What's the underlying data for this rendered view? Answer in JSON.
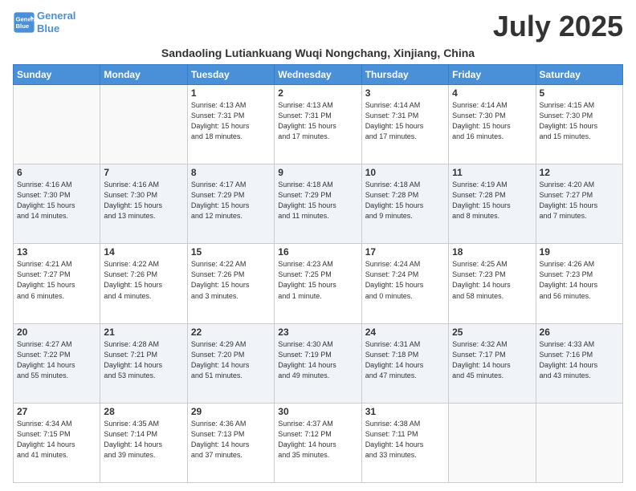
{
  "logo": {
    "line1": "General",
    "line2": "Blue"
  },
  "title": "July 2025",
  "subtitle": "Sandaoling Lutiankuang Wuqi Nongchang, Xinjiang, China",
  "days_of_week": [
    "Sunday",
    "Monday",
    "Tuesday",
    "Wednesday",
    "Thursday",
    "Friday",
    "Saturday"
  ],
  "weeks": [
    [
      {
        "day": "",
        "info": ""
      },
      {
        "day": "",
        "info": ""
      },
      {
        "day": "1",
        "info": "Sunrise: 4:13 AM\nSunset: 7:31 PM\nDaylight: 15 hours\nand 18 minutes."
      },
      {
        "day": "2",
        "info": "Sunrise: 4:13 AM\nSunset: 7:31 PM\nDaylight: 15 hours\nand 17 minutes."
      },
      {
        "day": "3",
        "info": "Sunrise: 4:14 AM\nSunset: 7:31 PM\nDaylight: 15 hours\nand 17 minutes."
      },
      {
        "day": "4",
        "info": "Sunrise: 4:14 AM\nSunset: 7:30 PM\nDaylight: 15 hours\nand 16 minutes."
      },
      {
        "day": "5",
        "info": "Sunrise: 4:15 AM\nSunset: 7:30 PM\nDaylight: 15 hours\nand 15 minutes."
      }
    ],
    [
      {
        "day": "6",
        "info": "Sunrise: 4:16 AM\nSunset: 7:30 PM\nDaylight: 15 hours\nand 14 minutes."
      },
      {
        "day": "7",
        "info": "Sunrise: 4:16 AM\nSunset: 7:30 PM\nDaylight: 15 hours\nand 13 minutes."
      },
      {
        "day": "8",
        "info": "Sunrise: 4:17 AM\nSunset: 7:29 PM\nDaylight: 15 hours\nand 12 minutes."
      },
      {
        "day": "9",
        "info": "Sunrise: 4:18 AM\nSunset: 7:29 PM\nDaylight: 15 hours\nand 11 minutes."
      },
      {
        "day": "10",
        "info": "Sunrise: 4:18 AM\nSunset: 7:28 PM\nDaylight: 15 hours\nand 9 minutes."
      },
      {
        "day": "11",
        "info": "Sunrise: 4:19 AM\nSunset: 7:28 PM\nDaylight: 15 hours\nand 8 minutes."
      },
      {
        "day": "12",
        "info": "Sunrise: 4:20 AM\nSunset: 7:27 PM\nDaylight: 15 hours\nand 7 minutes."
      }
    ],
    [
      {
        "day": "13",
        "info": "Sunrise: 4:21 AM\nSunset: 7:27 PM\nDaylight: 15 hours\nand 6 minutes."
      },
      {
        "day": "14",
        "info": "Sunrise: 4:22 AM\nSunset: 7:26 PM\nDaylight: 15 hours\nand 4 minutes."
      },
      {
        "day": "15",
        "info": "Sunrise: 4:22 AM\nSunset: 7:26 PM\nDaylight: 15 hours\nand 3 minutes."
      },
      {
        "day": "16",
        "info": "Sunrise: 4:23 AM\nSunset: 7:25 PM\nDaylight: 15 hours\nand 1 minute."
      },
      {
        "day": "17",
        "info": "Sunrise: 4:24 AM\nSunset: 7:24 PM\nDaylight: 15 hours\nand 0 minutes."
      },
      {
        "day": "18",
        "info": "Sunrise: 4:25 AM\nSunset: 7:23 PM\nDaylight: 14 hours\nand 58 minutes."
      },
      {
        "day": "19",
        "info": "Sunrise: 4:26 AM\nSunset: 7:23 PM\nDaylight: 14 hours\nand 56 minutes."
      }
    ],
    [
      {
        "day": "20",
        "info": "Sunrise: 4:27 AM\nSunset: 7:22 PM\nDaylight: 14 hours\nand 55 minutes."
      },
      {
        "day": "21",
        "info": "Sunrise: 4:28 AM\nSunset: 7:21 PM\nDaylight: 14 hours\nand 53 minutes."
      },
      {
        "day": "22",
        "info": "Sunrise: 4:29 AM\nSunset: 7:20 PM\nDaylight: 14 hours\nand 51 minutes."
      },
      {
        "day": "23",
        "info": "Sunrise: 4:30 AM\nSunset: 7:19 PM\nDaylight: 14 hours\nand 49 minutes."
      },
      {
        "day": "24",
        "info": "Sunrise: 4:31 AM\nSunset: 7:18 PM\nDaylight: 14 hours\nand 47 minutes."
      },
      {
        "day": "25",
        "info": "Sunrise: 4:32 AM\nSunset: 7:17 PM\nDaylight: 14 hours\nand 45 minutes."
      },
      {
        "day": "26",
        "info": "Sunrise: 4:33 AM\nSunset: 7:16 PM\nDaylight: 14 hours\nand 43 minutes."
      }
    ],
    [
      {
        "day": "27",
        "info": "Sunrise: 4:34 AM\nSunset: 7:15 PM\nDaylight: 14 hours\nand 41 minutes."
      },
      {
        "day": "28",
        "info": "Sunrise: 4:35 AM\nSunset: 7:14 PM\nDaylight: 14 hours\nand 39 minutes."
      },
      {
        "day": "29",
        "info": "Sunrise: 4:36 AM\nSunset: 7:13 PM\nDaylight: 14 hours\nand 37 minutes."
      },
      {
        "day": "30",
        "info": "Sunrise: 4:37 AM\nSunset: 7:12 PM\nDaylight: 14 hours\nand 35 minutes."
      },
      {
        "day": "31",
        "info": "Sunrise: 4:38 AM\nSunset: 7:11 PM\nDaylight: 14 hours\nand 33 minutes."
      },
      {
        "day": "",
        "info": ""
      },
      {
        "day": "",
        "info": ""
      }
    ]
  ]
}
